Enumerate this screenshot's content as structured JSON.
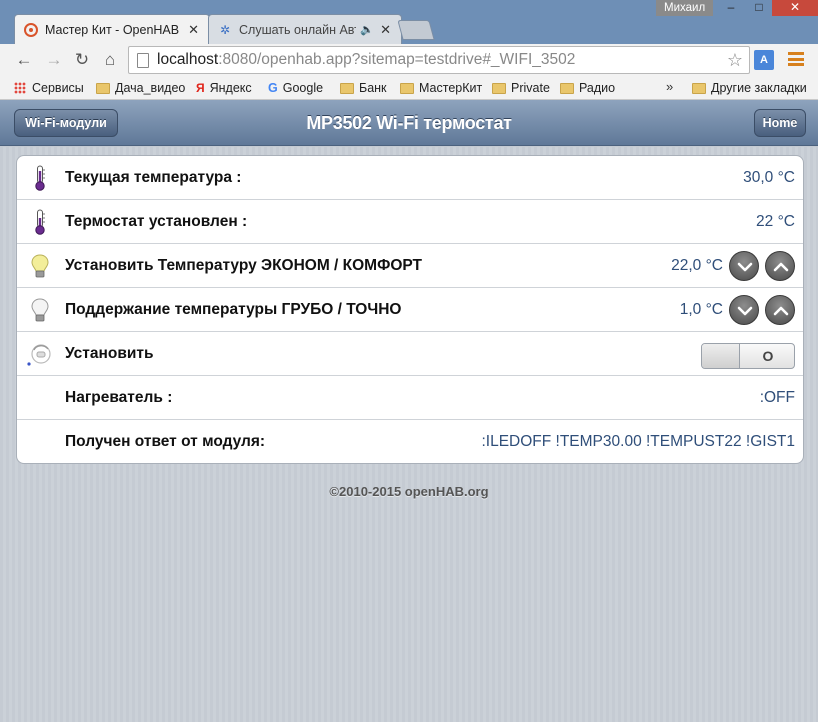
{
  "browser": {
    "tabs": [
      {
        "title": "Мастер Кит - OpenHAB",
        "active": true
      },
      {
        "title": "Слушать онлайн Авто",
        "active": false
      }
    ],
    "user": "Михаил",
    "url_host": "localhost",
    "url_rest": ":8080/openhab.app?sitemap=testdrive#_WIFI_3502",
    "translate_label": "A",
    "bookmarks": [
      {
        "label": "Сервисы",
        "icon": "apps-grid-icon"
      },
      {
        "label": "Дача_видео",
        "icon": "folder-icon"
      },
      {
        "label": "Яндекс",
        "icon": "yandex-icon"
      },
      {
        "label": "Google",
        "icon": "google-icon"
      },
      {
        "label": "Банк",
        "icon": "folder-icon"
      },
      {
        "label": "МастерКит",
        "icon": "folder-icon"
      },
      {
        "label": "Private",
        "icon": "folder-icon"
      },
      {
        "label": "Радио",
        "icon": "folder-icon"
      },
      {
        "label": "Другие закладки",
        "icon": "folder-icon"
      }
    ],
    "bookmarks_more": "»"
  },
  "header": {
    "back_label": "Wi-Fi-модули",
    "title": "MP3502 Wi-Fi термостат",
    "home_label": "Home"
  },
  "rows": [
    {
      "label": "Текущая температура :",
      "value": "30,0 °C",
      "icon": "thermometer-icon"
    },
    {
      "label": "Термостат установлен :",
      "value": "22 °C",
      "icon": "thermometer-icon"
    },
    {
      "label": "Установить Температуру ЭКОНОМ / КОМФОРТ",
      "value": "22,0 °C",
      "icon": "lightbulb-on-icon"
    },
    {
      "label": "Поддержание температуры ГРУБО / ТОЧНО",
      "value": "1,0 °C",
      "icon": "lightbulb-off-icon"
    },
    {
      "label": "Установить",
      "value": "O",
      "icon": "switch-icon"
    },
    {
      "label": "Нагреватель :",
      "value": ":OFF"
    },
    {
      "label": "Получен ответ от модуля:",
      "value": ":ILEDOFF !TEMP30.00 !TEMPUST22 !GIST1"
    }
  ],
  "footer": "©2010-2015 openHAB.org",
  "colors": {
    "header": "#5f7898",
    "value_text": "#2f4e79",
    "accent_close": "#c7493c"
  }
}
